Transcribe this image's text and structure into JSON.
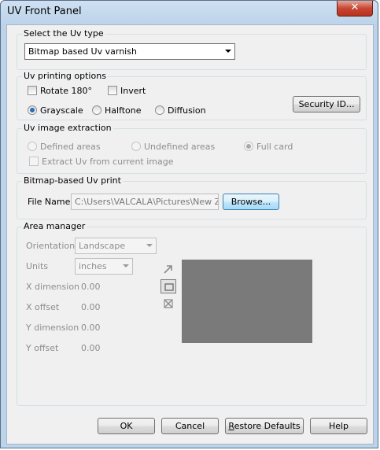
{
  "window": {
    "title": "UV Front Panel",
    "close_glyph": "✕"
  },
  "uv_type": {
    "group_label": "Select the Uv type",
    "selected": "Bitmap based Uv varnish"
  },
  "printing_options": {
    "group_label": "Uv printing options",
    "rotate_label": "Rotate 180°",
    "invert_label": "Invert",
    "grayscale_label": "Grayscale",
    "halftone_label": "Halftone",
    "diffusion_label": "Diffusion",
    "security_button": "Security ID...",
    "selected_mode": "Grayscale"
  },
  "extraction": {
    "group_label": "Uv image extraction",
    "defined_label": "Defined areas",
    "undefined_label": "Undefined areas",
    "fullcard_label": "Full card",
    "extract_label": "Extract Uv from current image",
    "selected": "Full card"
  },
  "bitmap_print": {
    "group_label": "Bitmap-based Uv print",
    "file_label": "File Name",
    "file_value": "C:\\Users\\VALCALA\\Pictures\\New Zebra",
    "browse_button": "Browse..."
  },
  "area_manager": {
    "group_label": "Area manager",
    "orientation_label": "Orientation",
    "orientation_value": "Landscape",
    "units_label": "Units",
    "units_value": "inches",
    "x_dim_label": "X dimension",
    "x_dim_value": "0.00",
    "x_off_label": "X offset",
    "x_off_value": "0.00",
    "y_dim_label": "Y dimension",
    "y_dim_value": "0.00",
    "y_off_label": "Y offset",
    "y_off_value": "0.00",
    "preview_color": "#7a7a7a"
  },
  "footer": {
    "ok": "OK",
    "cancel": "Cancel",
    "restore_prefix": "R",
    "restore_rest": "estore Defaults",
    "help": "Help"
  }
}
